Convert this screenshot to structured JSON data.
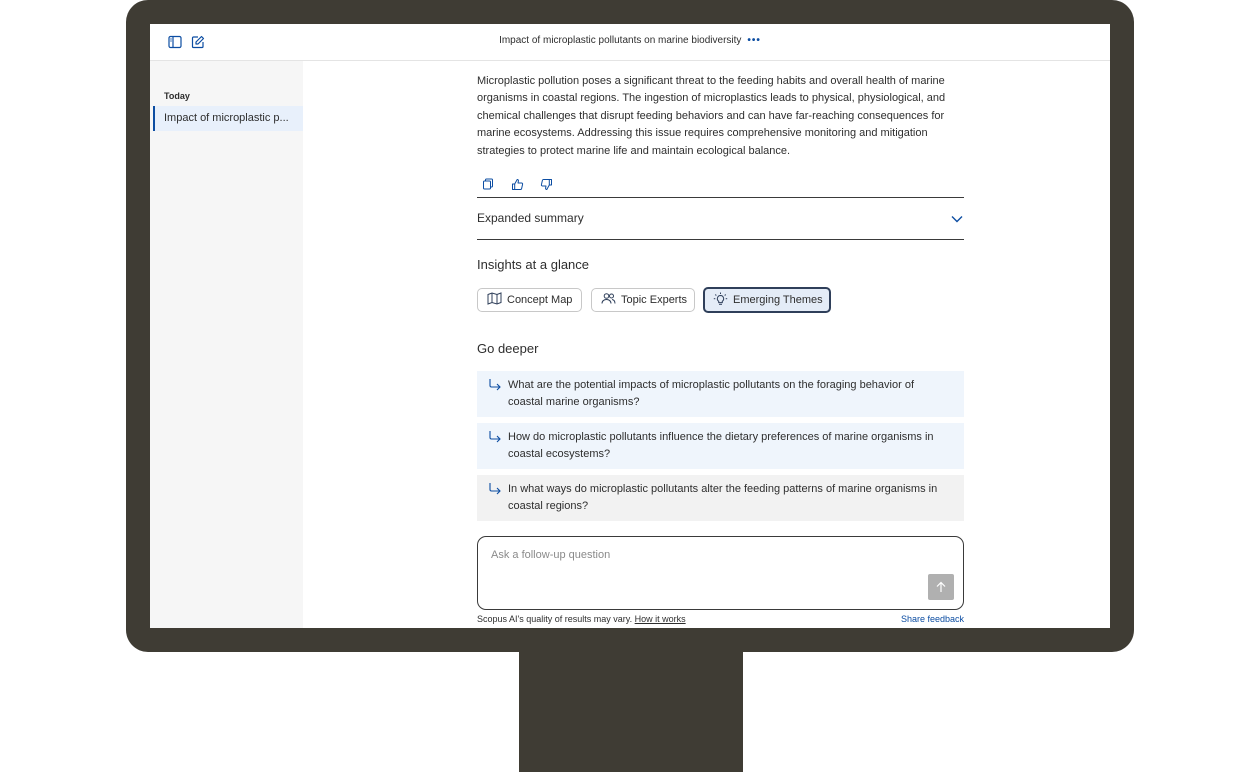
{
  "header": {
    "conversation_title": "Impact of microplastic pollutants on marine biodiversity",
    "more_label": "•••",
    "icons": {
      "sidebar_toggle": "sidebar-toggle-icon",
      "new_chat": "edit-icon",
      "more": "more-icon"
    }
  },
  "sidebar": {
    "section_label": "Today",
    "items": [
      {
        "label": "Impact of microplastic p..."
      }
    ]
  },
  "answer": {
    "summary_text": "Microplastic pollution poses a significant threat to the feeding habits and overall health of marine organisms in coastal regions. The ingestion of microplastics leads to physical, physiological, and chemical challenges that disrupt feeding behaviors and can have far-reaching consequences for marine ecosystems. Addressing this issue requires comprehensive monitoring and mitigation strategies to protect marine life and maintain ecological balance.",
    "action_icons": [
      "copy-icon",
      "thumbs-up-icon",
      "thumbs-down-icon"
    ],
    "expanded_summary_label": "Expanded summary"
  },
  "insights": {
    "heading": "Insights at a glance",
    "chips": [
      {
        "label": "Concept Map",
        "icon": "map-icon",
        "active": false
      },
      {
        "label": "Topic Experts",
        "icon": "people-icon",
        "active": false
      },
      {
        "label": "Emerging Themes",
        "icon": "lightbulb-icon",
        "active": true
      }
    ]
  },
  "go_deeper": {
    "heading": "Go deeper",
    "questions": [
      {
        "text": "What are the potential impacts of microplastic pollutants on the foraging behavior of coastal marine organisms?"
      },
      {
        "text": "How do microplastic pollutants influence the dietary preferences of marine organisms in coastal ecosystems?"
      },
      {
        "text": "In what ways do microplastic pollutants alter the feeding patterns of marine organisms in coastal regions?"
      }
    ]
  },
  "composer": {
    "placeholder": "Ask a follow-up question",
    "value": ""
  },
  "footer": {
    "disclaimer": "Scopus AI's quality of results may vary.",
    "how_it_works": "How it works",
    "share_feedback": "Share feedback"
  },
  "colors": {
    "accent": "#0c4da2",
    "bezel": "#3f3c34",
    "question_bg": "#eff5fc",
    "active_chip_bg": "#e4ecf7"
  }
}
